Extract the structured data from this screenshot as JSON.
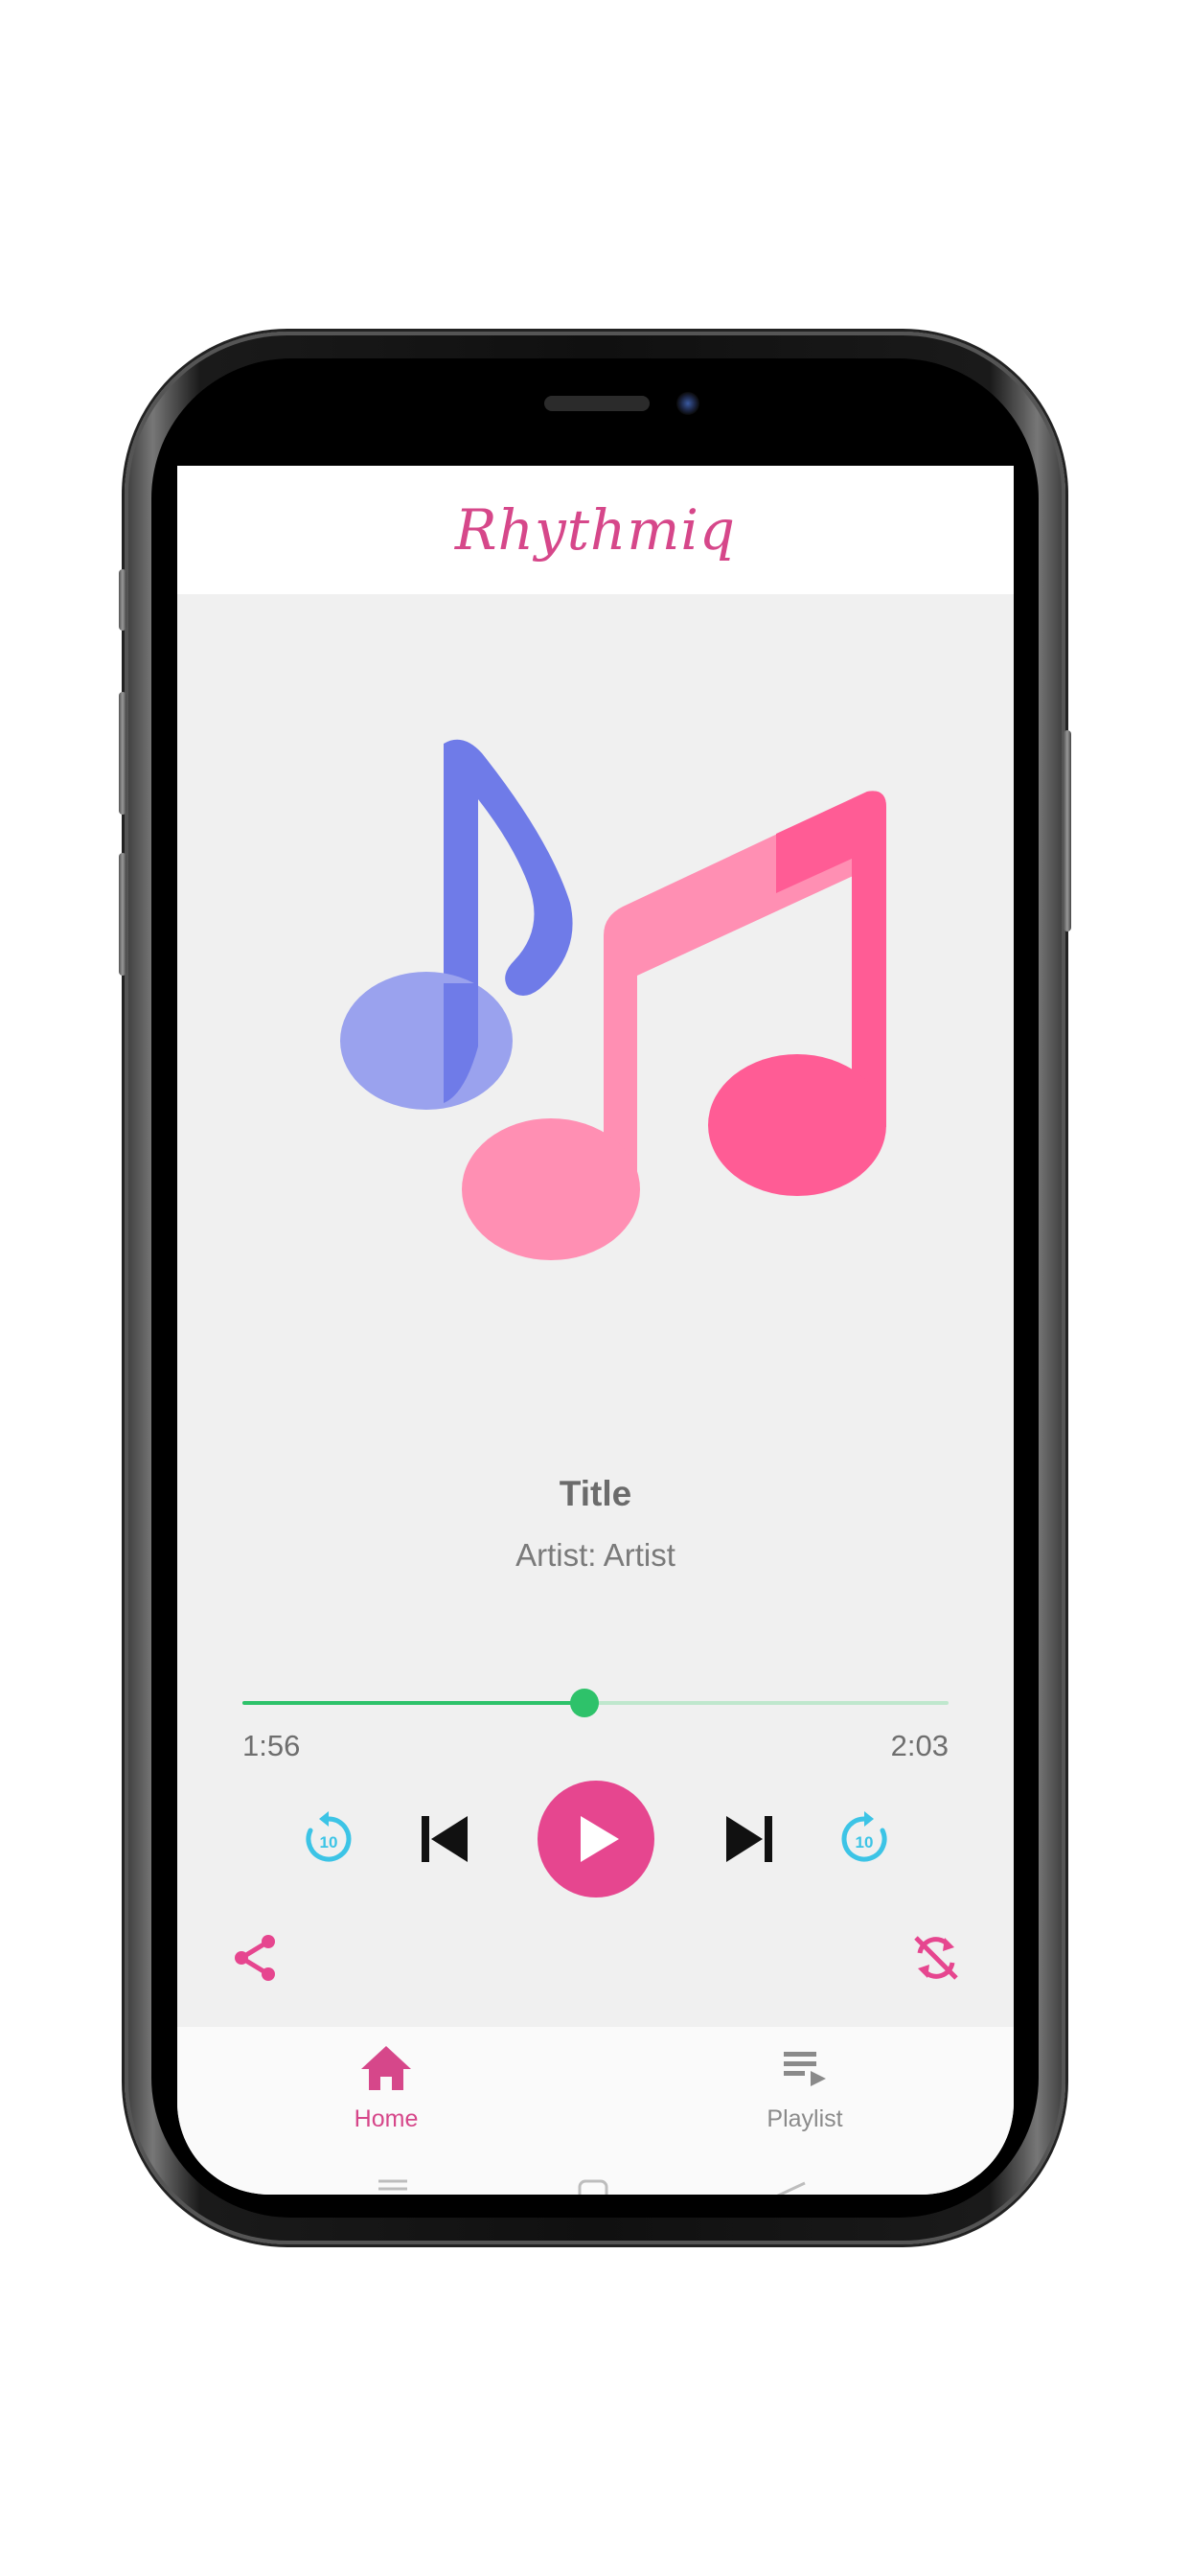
{
  "app": {
    "title": "Rhythmiq"
  },
  "now_playing": {
    "title": "Title",
    "artist": "Artist: Artist",
    "current_time": "1:56",
    "total_time": "2:03",
    "progress": 0.484
  },
  "controls": {
    "icons": [
      "replay-10-icon",
      "skip-previous-icon",
      "play-icon",
      "skip-next-icon",
      "forward-10-icon",
      "share-icon",
      "shuffle-off-icon"
    ],
    "replay_label": "10",
    "forward_label": "10"
  },
  "bottom_nav": {
    "items": [
      {
        "label": "Home",
        "icon": "home-icon",
        "active": true
      },
      {
        "label": "Playlist",
        "icon": "playlist-icon",
        "active": false
      }
    ]
  },
  "colors": {
    "accent": "#e6468f",
    "progress": "#2ec26a",
    "progress_track": "#bfe7cd",
    "skip_icons": "#3cc4e6",
    "note_blue": "#6f7be8",
    "note_pink": "#ff5c95"
  }
}
